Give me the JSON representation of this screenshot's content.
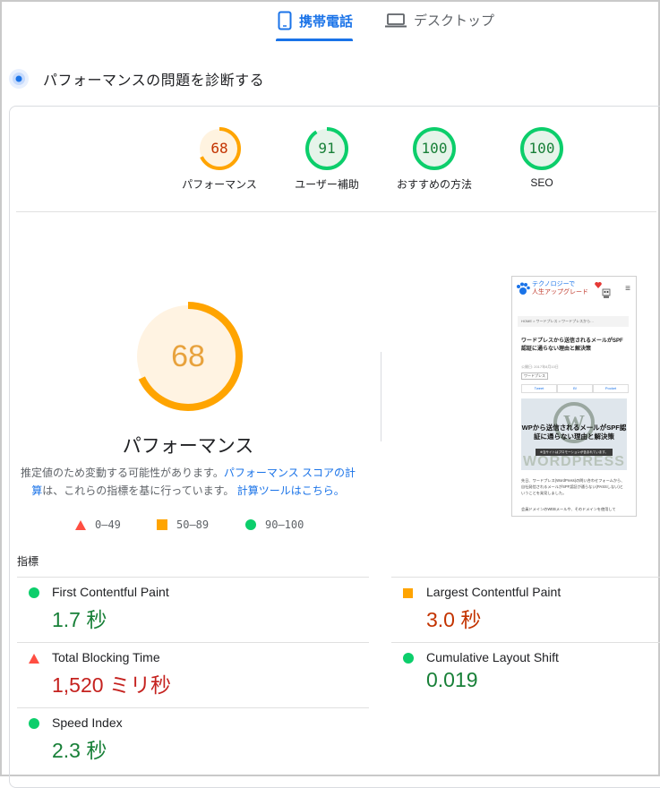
{
  "tabs": {
    "mobile": "携帯電話",
    "desktop": "デスクトップ"
  },
  "diagnose": {
    "title": "パフォーマンスの問題を診断する"
  },
  "categories": [
    {
      "score": "68",
      "label": "パフォーマンス",
      "score_fraction": 0.68,
      "color": "#ffa400",
      "bg": "#fff3e0",
      "text_color": "#c33300"
    },
    {
      "score": "91",
      "label": "ユーザー補助",
      "score_fraction": 0.91,
      "color": "#0cce6b",
      "bg": "#e6f4ea",
      "text_color": "#188038"
    },
    {
      "score": "100",
      "label": "おすすめの方法",
      "score_fraction": 1.0,
      "color": "#0cce6b",
      "bg": "#e6f4ea",
      "text_color": "#188038"
    },
    {
      "score": "100",
      "label": "SEO",
      "score_fraction": 1.0,
      "color": "#0cce6b",
      "bg": "#e6f4ea",
      "text_color": "#188038"
    }
  ],
  "main_gauge": {
    "score": "68",
    "score_fraction": 0.68,
    "title": "パフォーマンス",
    "color": "#ffa400"
  },
  "description": {
    "text1": "推定値のため変動する可能性があります。",
    "link1": "パフォーマンス スコアの計算",
    "text2": "は、これらの指標を基に行っています。",
    "link2": "計算ツールはこちら。"
  },
  "legend": [
    {
      "range": "0–49",
      "shape": "triangle",
      "color": "#ff4e42"
    },
    {
      "range": "50–89",
      "shape": "square",
      "color": "#ffa400"
    },
    {
      "range": "90–100",
      "shape": "circle",
      "color": "#0cce6b"
    }
  ],
  "thumbnail": {
    "site_title": "テクノロジーで",
    "site_subtitle": "人生アップグレード",
    "breadcrumb": "HOME  >  ワードプレス  >  ワードプレスから…",
    "article_title": "ワードプレスから送信されるメールがSPF認証に通らない理由と解決策",
    "meta": "公開日: 2017年8月10日",
    "tag": "ワードプレス",
    "share": [
      "Tweet",
      "B!",
      "Pocket"
    ],
    "hero_text": "WPから送信されるメールがSPF認証に通らない理由と解決策",
    "hero_bar": "※当サイトはプロモーションが含まれています。",
    "hero_wp": "WORDPRESS",
    "body1": "先日、ワードプレス(WordPress)の問い合わせフォームから、自社発信されるメールがSPF認証が通らない(PASSしない)ということを発見しました。",
    "body2": "会員ドメインのWEBメールや、そのドメインを使用して"
  },
  "metrics": {
    "heading": "指標",
    "items": [
      {
        "name": "First Contentful Paint",
        "value": "1.7 秒",
        "rating": "good"
      },
      {
        "name": "Largest Contentful Paint",
        "value": "3.0 秒",
        "rating": "average"
      },
      {
        "name": "Total Blocking Time",
        "value": "1,520 ミリ秒",
        "rating": "poor"
      },
      {
        "name": "Cumulative Layout Shift",
        "value": "0.019",
        "rating": "good"
      },
      {
        "name": "Speed Index",
        "value": "2.3 秒",
        "rating": "good"
      }
    ]
  }
}
